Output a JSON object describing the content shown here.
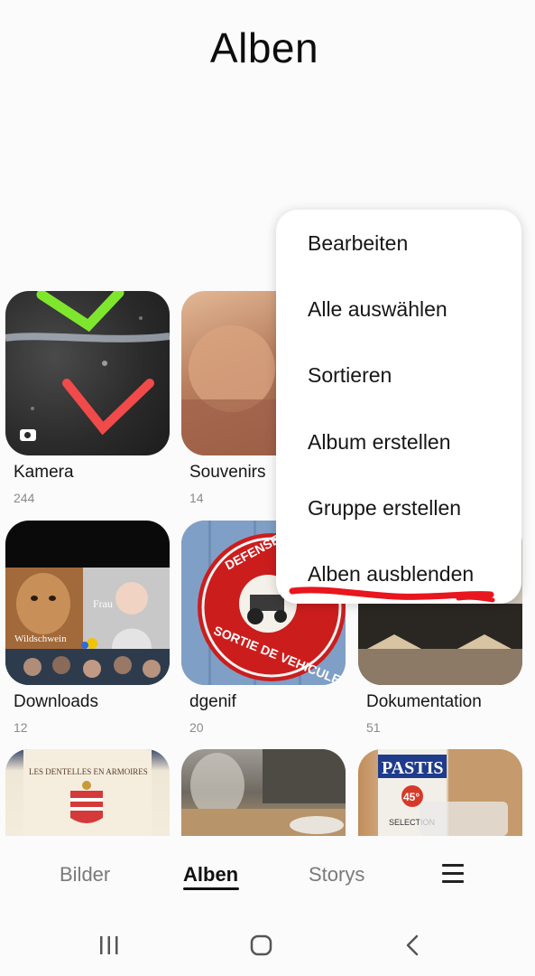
{
  "header": {
    "title": "Alben"
  },
  "albums": [
    {
      "name": "Kamera",
      "count": "244"
    },
    {
      "name": "Souvenirs",
      "count": "14"
    },
    {
      "name": "Downloads",
      "count": "12"
    },
    {
      "name": "dgenif",
      "count": "20"
    },
    {
      "name": "Dokumentation",
      "count": "51"
    }
  ],
  "thumbnail_text": {
    "downloads_label_1": "Frau",
    "downloads_label_2": "Wildschwein",
    "dgenif_sign_top": "DEFENSE STATIONNER",
    "dgenif_sign_bottom": "SORTIE DE VEHICULES",
    "wine_label": "LES DENTELLES EN ARMOIRES",
    "pastis_label": "PASTIS",
    "pastis_badge": "45°",
    "pastis_sub": "SELECTION"
  },
  "menu": {
    "items": [
      "Bearbeiten",
      "Alle auswählen",
      "Sortieren",
      "Album erstellen",
      "Gruppe erstellen",
      "Alben ausblenden"
    ],
    "highlight_color": "#e8161e"
  },
  "tabs": [
    {
      "label": "Bilder",
      "active": false
    },
    {
      "label": "Alben",
      "active": true
    },
    {
      "label": "Storys",
      "active": false
    }
  ],
  "icons": {
    "menu": "hamburger-icon",
    "nav_recents": "recent-apps-icon",
    "nav_home": "home-icon",
    "nav_back": "back-icon"
  }
}
